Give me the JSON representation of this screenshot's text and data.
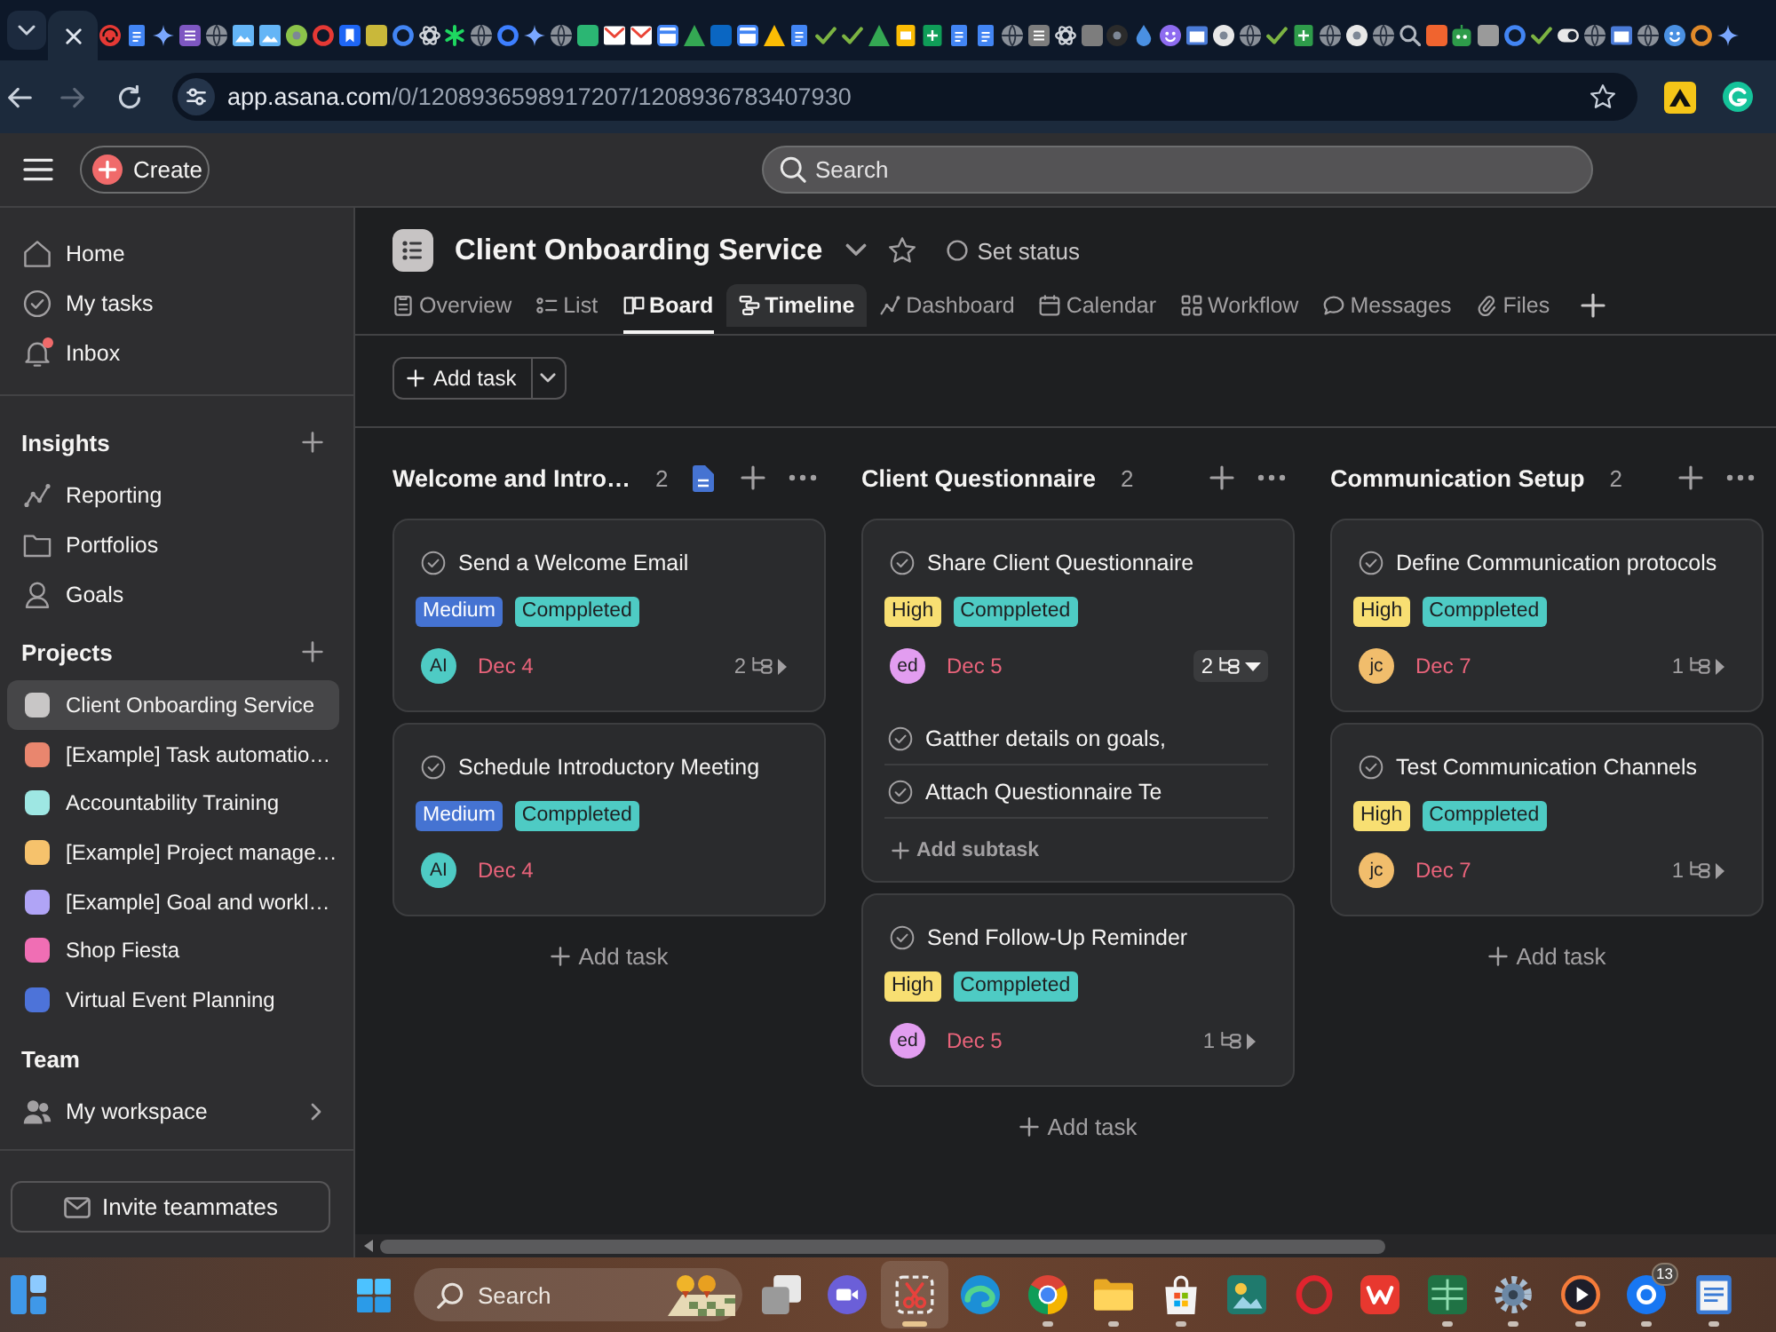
{
  "browser": {
    "url_host": "app.asana.com",
    "url_path": "/0/1208936598917207/1208936783407930"
  },
  "topbar": {
    "create": "Create",
    "search_placeholder": "Search"
  },
  "sidebar": {
    "nav": [
      {
        "kind": "home",
        "label": "Home",
        "badge": false
      },
      {
        "kind": "tasks",
        "label": "My tasks",
        "badge": false
      },
      {
        "kind": "inbox",
        "label": "Inbox",
        "badge": true
      }
    ],
    "insights": {
      "title": "Insights",
      "items": [
        {
          "kind": "reporting",
          "label": "Reporting"
        },
        {
          "kind": "portfolios",
          "label": "Portfolios"
        },
        {
          "kind": "goals",
          "label": "Goals"
        }
      ]
    },
    "projects": {
      "title": "Projects",
      "items": [
        {
          "name": "Client Onboarding Service",
          "color": "#c8c6c6",
          "selected": true
        },
        {
          "name": "[Example] Task automatio…",
          "color": "#e9866e",
          "selected": false
        },
        {
          "name": "Accountability Training",
          "color": "#9ee7e3",
          "selected": false
        },
        {
          "name": "[Example] Project manage…",
          "color": "#f6c26c",
          "selected": false
        },
        {
          "name": "[Example] Goal and workl…",
          "color": "#b0a4f6",
          "selected": false
        },
        {
          "name": "Shop Fiesta",
          "color": "#f06eb4",
          "selected": false
        },
        {
          "name": "Virtual Event Planning",
          "color": "#4d73d9",
          "selected": false
        }
      ]
    },
    "team": {
      "title": "Team",
      "items": [
        {
          "kind": "workspace",
          "label": "My workspace"
        }
      ]
    },
    "invite": "Invite teammates"
  },
  "project": {
    "title": "Client Onboarding Service",
    "status": "Set status",
    "tabs": [
      {
        "kind": "overview",
        "label": "Overview",
        "selected": false,
        "hovered": false
      },
      {
        "kind": "list",
        "label": "List",
        "selected": false,
        "hovered": false
      },
      {
        "kind": "board",
        "label": "Board",
        "selected": true,
        "hovered": false
      },
      {
        "kind": "timeline",
        "label": "Timeline",
        "selected": false,
        "hovered": true
      },
      {
        "kind": "dashboard",
        "label": "Dashboard",
        "selected": false,
        "hovered": false
      },
      {
        "kind": "calendar",
        "label": "Calendar",
        "selected": false,
        "hovered": false
      },
      {
        "kind": "workflow",
        "label": "Workflow",
        "selected": false,
        "hovered": false
      },
      {
        "kind": "messages",
        "label": "Messages",
        "selected": false,
        "hovered": false
      },
      {
        "kind": "files",
        "label": "Files",
        "selected": false,
        "hovered": false
      }
    ],
    "add_task": "Add task"
  },
  "columns": [
    {
      "title": "Welcome and Intro…",
      "count": "2",
      "doc": true,
      "add_task": "Add task",
      "cards": [
        {
          "title": "Send a Welcome Email",
          "tags": [
            {
              "label": "Medium",
              "color": "#4573d2"
            },
            {
              "label": "Comppleted",
              "color": "#4ecbc4"
            }
          ],
          "assignee": {
            "initials": "AI",
            "color": "#4ecbc4"
          },
          "due": "Dec 4",
          "subtasks": {
            "count": "2",
            "expanded": false
          }
        },
        {
          "title": "Schedule Introductory Meeting",
          "tags": [
            {
              "label": "Medium",
              "color": "#4573d2"
            },
            {
              "label": "Comppleted",
              "color": "#4ecbc4"
            }
          ],
          "assignee": {
            "initials": "AI",
            "color": "#4ecbc4"
          },
          "due": "Dec 4"
        }
      ]
    },
    {
      "title": "Client Questionnaire",
      "count": "2",
      "doc": false,
      "add_task": "Add task",
      "cards": [
        {
          "title": "Share Client Questionnaire",
          "tags": [
            {
              "label": "High",
              "color": "#f8df72"
            },
            {
              "label": "Comppleted",
              "color": "#4ecbc4"
            }
          ],
          "assignee": {
            "initials": "ed",
            "color": "#e29df0"
          },
          "due": "Dec 5",
          "subtasks": {
            "count": "2",
            "expanded": true,
            "items": [
              "Gatther details on goals,",
              "Attach Questionnaire Te"
            ],
            "add": "Add subtask"
          }
        },
        {
          "title": "Send Follow-Up Reminder",
          "tags": [
            {
              "label": "High",
              "color": "#f8df72"
            },
            {
              "label": "Comppleted",
              "color": "#4ecbc4"
            }
          ],
          "assignee": {
            "initials": "ed",
            "color": "#e29df0"
          },
          "due": "Dec 5",
          "subtasks": {
            "count": "1",
            "expanded": false
          }
        }
      ]
    },
    {
      "title": "Communication Setup",
      "count": "2",
      "doc": false,
      "add_task": "Add task",
      "cards": [
        {
          "title": "Define Communication protocols",
          "tags": [
            {
              "label": "High",
              "color": "#f8df72"
            },
            {
              "label": "Comppleted",
              "color": "#4ecbc4"
            }
          ],
          "assignee": {
            "initials": "jc",
            "color": "#f1bd6c"
          },
          "due": "Dec 7",
          "subtasks": {
            "count": "1",
            "expanded": false
          }
        },
        {
          "title": "Test Communication Channels",
          "tags": [
            {
              "label": "High",
              "color": "#f8df72"
            },
            {
              "label": "Comppleted",
              "color": "#4ecbc4"
            }
          ],
          "assignee": {
            "initials": "jc",
            "color": "#f1bd6c"
          },
          "due": "Dec 7",
          "subtasks": {
            "count": "1",
            "expanded": false
          }
        }
      ]
    }
  ],
  "taskbar": {
    "search_placeholder": "Search",
    "apps": [
      {
        "kind": "taskview",
        "running": false,
        "active": false
      },
      {
        "kind": "meet",
        "running": false,
        "active": false
      },
      {
        "kind": "snip",
        "running": true,
        "active": true
      },
      {
        "kind": "swirl",
        "running": false,
        "active": false
      },
      {
        "kind": "segmented",
        "running": true,
        "active": false
      },
      {
        "kind": "folder",
        "running": true,
        "active": false
      },
      {
        "kind": "bag",
        "running": true,
        "active": false
      },
      {
        "kind": "tile",
        "running": false,
        "active": false
      },
      {
        "kind": "ring",
        "running": false,
        "active": false
      },
      {
        "kind": "zigzag",
        "running": false,
        "active": false
      },
      {
        "kind": "sheet",
        "running": true,
        "active": false
      },
      {
        "kind": "gear",
        "running": true,
        "active": false
      },
      {
        "kind": "play",
        "running": true,
        "active": false
      },
      {
        "kind": "disc",
        "running": true,
        "active": false,
        "badge": "13"
      },
      {
        "kind": "notepad",
        "running": true,
        "active": false
      }
    ]
  }
}
